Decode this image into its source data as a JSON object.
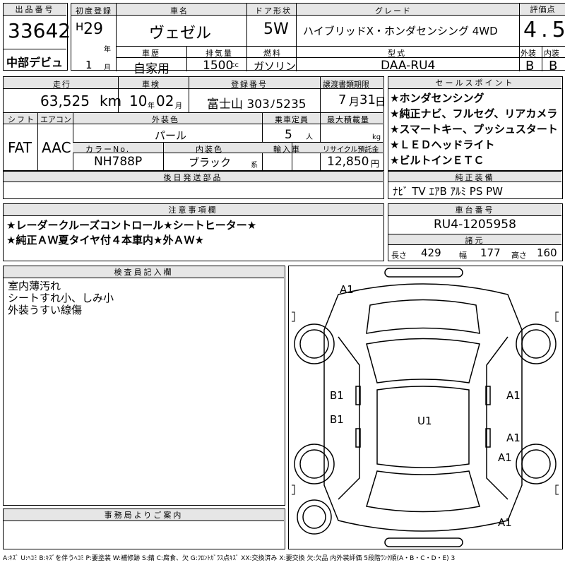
{
  "headers": {
    "lot_no": "出品番号",
    "first_reg": "初度登録",
    "car_name": "車名",
    "door": "ドア形状",
    "grade": "グレード",
    "score": "評価点",
    "history": "車歴",
    "displacement": "排気量",
    "fuel": "燃料",
    "model_code": "型式",
    "exterior": "外装",
    "interior": "内装",
    "mileage": "走行",
    "inspection": "車検",
    "reg_no": "登録番号",
    "transfer_deadline": "譲渡書類期限",
    "sales_points": "セールスポイント",
    "shift": "シフト",
    "aircon": "エアコン",
    "ext_color": "外装色",
    "capacity": "乗車定員",
    "max_load": "最大積載量",
    "color_no": "カラーNo.",
    "int_color": "内装色",
    "import": "輸入車",
    "recycle": "リサイクル預託金",
    "later_parts": "後日発送部品",
    "equipment": "純正装備",
    "notes": "注意事項欄",
    "chassis_no": "車台番号",
    "dimensions": "諸元",
    "inspector": "検査員記入欄",
    "office": "事務局よりご案内"
  },
  "lot": {
    "number": "33642",
    "venue": "中部デビュ"
  },
  "registration": {
    "era": "H",
    "year": "29",
    "year_unit": "年",
    "month": "1",
    "month_unit": "月"
  },
  "car": {
    "name": "ヴェゼル",
    "door": "5W",
    "grade": "ハイブリッドX・ホンダセンシング 4WD"
  },
  "score": {
    "overall": "4.5",
    "exterior": "B",
    "interior": "B"
  },
  "details": {
    "history": "自家用",
    "displacement": "1500",
    "displacement_unit": "cc",
    "fuel": "ガソリン",
    "model_code": "DAA-RU4"
  },
  "row2": {
    "mileage": "63,525",
    "mileage_unit": "km",
    "inspection_year": "10",
    "inspection_year_unit": "年",
    "inspection_month": "02",
    "inspection_month_unit": "月",
    "reg_no": "富士山 303ﾉ5235",
    "transfer_month": "7",
    "transfer_month_unit": "月",
    "transfer_day": "31",
    "transfer_day_unit": "日"
  },
  "row3": {
    "shift": "FAT",
    "aircon": "AAC",
    "ext_color": "パール",
    "capacity": "5",
    "capacity_unit": "人",
    "max_load_unit": "kg",
    "color_no": "NH788P",
    "int_color": "ブラック",
    "int_color_suffix": "系",
    "recycle": "12,850",
    "recycle_unit": "円"
  },
  "sales_points": [
    "★ホンダセンシング",
    "★純正ナビ、フルセグ、リアカメラ",
    "★スマートキー、プッシュスタート",
    "★ＬＥＤヘッドライト",
    "★ビルトインＥＴＣ"
  ],
  "equipment": "ﾅﾋﾞ TV ｴｱB ｱﾙﾐ PS PW",
  "notes": [
    "★レーダークルーズコントロール★シートヒーター★",
    "★純正ＡＷ夏タイヤ付４本車内★外ＡＷ★"
  ],
  "chassis_no": "RU4-1205958",
  "dims": {
    "length_label": "長さ",
    "length": "429",
    "width_label": "幅",
    "width": "177",
    "height_label": "高さ",
    "height": "160"
  },
  "inspector_notes": [
    "室内薄汚れ",
    "シートすれ小、しみ小",
    "外装うすい線傷"
  ],
  "diagram_marks": {
    "front_a1": "A1",
    "left_b1_front": "B1",
    "left_b1_rear": "B1",
    "roof_u1": "U1",
    "right_a1_front": "A1",
    "right_a1_mid": "A1",
    "right_a1_rear": "A1",
    "rear_a1": "A1"
  },
  "legend": "A:ｷｽﾞ U:ﾍｺﾐ B:ｷｽﾞを伴うﾍｺﾐ P:要塗装 W:補修跡 S:錆 C:腐食、欠 G:ﾌﾛﾝﾄｶﾞﾗｽ点ｷｽﾞ XX:交換済み X:要交換 欠:欠品 内外装評価 5段階ﾗﾝｸ順(A・B・C・D・E) 3"
}
